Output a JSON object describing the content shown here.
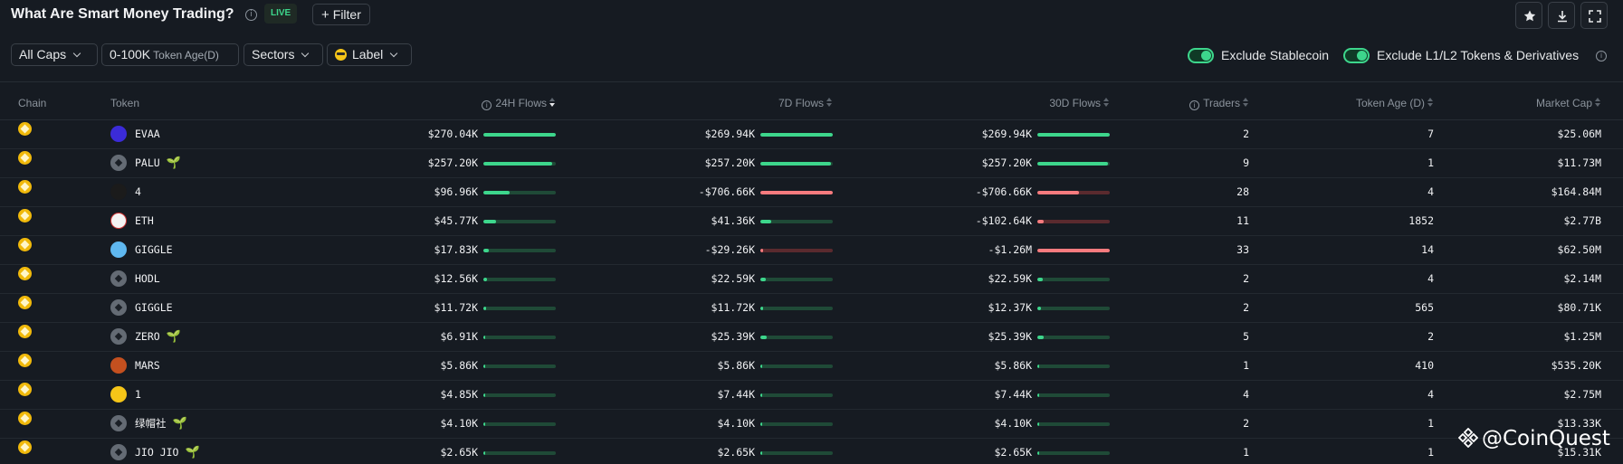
{
  "header": {
    "title": "What Are Smart Money Trading?",
    "live_badge": "LIVE",
    "filter_button": "Filter"
  },
  "filters": {
    "caps": "All Caps",
    "token_age": "0-100K",
    "token_age_sub": "Token Age(D)",
    "sectors": "Sectors",
    "label": "Label",
    "exclude_stablecoin": "Exclude Stablecoin",
    "exclude_l1l2": "Exclude L1/L2 Tokens & Derivatives"
  },
  "columns": {
    "chain": "Chain",
    "token": "Token",
    "flows_24h": "24H Flows",
    "flows_7d": "7D Flows",
    "flows_30d": "30D Flows",
    "traders": "Traders",
    "token_age": "Token Age (D)",
    "market_cap": "Market Cap"
  },
  "rows": [
    {
      "token": "EVAA",
      "icon": "evaa",
      "leaf": false,
      "f24": "$270.04K",
      "f24_level": 1.0,
      "f24_sign": "pos",
      "f7": "$269.94K",
      "f7_level": 1.0,
      "f7_sign": "pos",
      "f30": "$269.94K",
      "f30_level": 1.0,
      "f30_sign": "pos",
      "traders": "2",
      "age": "7",
      "mcap": "$25.06M"
    },
    {
      "token": "PALU",
      "icon": "generic",
      "leaf": true,
      "f24": "$257.20K",
      "f24_level": 0.95,
      "f24_sign": "pos",
      "f7": "$257.20K",
      "f7_level": 0.97,
      "f7_sign": "pos",
      "f30": "$257.20K",
      "f30_level": 0.97,
      "f30_sign": "pos",
      "traders": "9",
      "age": "1",
      "mcap": "$11.73M"
    },
    {
      "token": "4",
      "icon": "four",
      "leaf": false,
      "f24": "$96.96K",
      "f24_level": 0.36,
      "f24_sign": "pos",
      "f7": "-$706.66K",
      "f7_level": 1.0,
      "f7_sign": "neg",
      "f30": "-$706.66K",
      "f30_level": 0.57,
      "f30_sign": "neg",
      "traders": "28",
      "age": "4",
      "mcap": "$164.84M"
    },
    {
      "token": "ETH",
      "icon": "eth",
      "leaf": false,
      "f24": "$45.77K",
      "f24_level": 0.17,
      "f24_sign": "pos",
      "f7": "$41.36K",
      "f7_level": 0.15,
      "f7_sign": "pos",
      "f30": "-$102.64K",
      "f30_level": 0.09,
      "f30_sign": "neg",
      "traders": "11",
      "age": "1852",
      "mcap": "$2.77B"
    },
    {
      "token": "GIGGLE",
      "icon": "giggle",
      "leaf": false,
      "f24": "$17.83K",
      "f24_level": 0.07,
      "f24_sign": "pos",
      "f7": "-$29.26K",
      "f7_level": 0.04,
      "f7_sign": "neg",
      "f30": "-$1.26M",
      "f30_level": 1.0,
      "f30_sign": "neg",
      "traders": "33",
      "age": "14",
      "mcap": "$62.50M"
    },
    {
      "token": "HODL",
      "icon": "generic",
      "leaf": false,
      "f24": "$12.56K",
      "f24_level": 0.05,
      "f24_sign": "pos",
      "f7": "$22.59K",
      "f7_level": 0.08,
      "f7_sign": "pos",
      "f30": "$22.59K",
      "f30_level": 0.08,
      "f30_sign": "pos",
      "traders": "2",
      "age": "4",
      "mcap": "$2.14M"
    },
    {
      "token": "GIGGLE",
      "icon": "generic",
      "leaf": false,
      "f24": "$11.72K",
      "f24_level": 0.04,
      "f24_sign": "pos",
      "f7": "$11.72K",
      "f7_level": 0.04,
      "f7_sign": "pos",
      "f30": "$12.37K",
      "f30_level": 0.05,
      "f30_sign": "pos",
      "traders": "2",
      "age": "565",
      "mcap": "$80.71K"
    },
    {
      "token": "ZERO",
      "icon": "generic",
      "leaf": true,
      "f24": "$6.91K",
      "f24_level": 0.03,
      "f24_sign": "pos",
      "f7": "$25.39K",
      "f7_level": 0.09,
      "f7_sign": "pos",
      "f30": "$25.39K",
      "f30_level": 0.09,
      "f30_sign": "pos",
      "traders": "5",
      "age": "2",
      "mcap": "$1.25M"
    },
    {
      "token": "MARS",
      "icon": "mars",
      "leaf": false,
      "f24": "$5.86K",
      "f24_level": 0.02,
      "f24_sign": "pos",
      "f7": "$5.86K",
      "f7_level": 0.02,
      "f7_sign": "pos",
      "f30": "$5.86K",
      "f30_level": 0.02,
      "f30_sign": "pos",
      "traders": "1",
      "age": "410",
      "mcap": "$535.20K"
    },
    {
      "token": "1",
      "icon": "one",
      "leaf": false,
      "f24": "$4.85K",
      "f24_level": 0.02,
      "f24_sign": "pos",
      "f7": "$7.44K",
      "f7_level": 0.03,
      "f7_sign": "pos",
      "f30": "$7.44K",
      "f30_level": 0.03,
      "f30_sign": "pos",
      "traders": "4",
      "age": "4",
      "mcap": "$2.75M"
    },
    {
      "token": "绿帽社",
      "icon": "generic",
      "leaf": true,
      "f24": "$4.10K",
      "f24_level": 0.015,
      "f24_sign": "pos",
      "f7": "$4.10K",
      "f7_level": 0.015,
      "f7_sign": "pos",
      "f30": "$4.10K",
      "f30_level": 0.015,
      "f30_sign": "pos",
      "traders": "2",
      "age": "1",
      "mcap": "$13.33K"
    },
    {
      "token": "JIO JIO",
      "icon": "generic",
      "leaf": true,
      "f24": "$2.65K",
      "f24_level": 0.01,
      "f24_sign": "pos",
      "f7": "$2.65K",
      "f7_level": 0.01,
      "f7_sign": "pos",
      "f30": "$2.65K",
      "f30_level": 0.01,
      "f30_sign": "pos",
      "traders": "1",
      "age": "1",
      "mcap": "$15.31K"
    }
  ],
  "watermark": "@CoinQuest",
  "colors": {
    "positive": "#3dd68c",
    "negative": "#f77b7e",
    "chain_bnb": "#f0b90b",
    "background": "#161b22"
  }
}
